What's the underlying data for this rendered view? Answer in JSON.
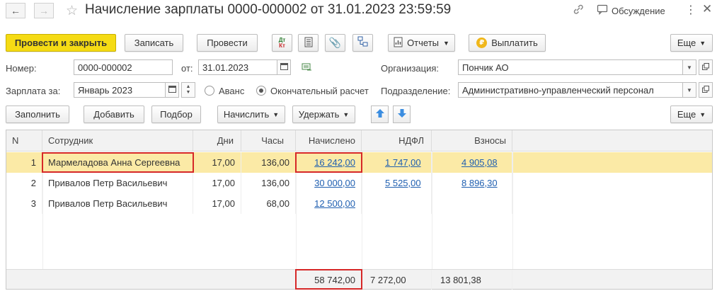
{
  "window": {
    "title": "Начисление зарплаты 0000-000002 от 31.01.2023 23:59:59",
    "discussion_label": "Обсуждение"
  },
  "toolbar": {
    "post_close": "Провести и закрыть",
    "save": "Записать",
    "post": "Провести",
    "dtkt_top": "Дт",
    "dtkt_bottom": "Кт",
    "reports": "Отчеты",
    "pay": "Выплатить",
    "more": "Еще"
  },
  "form": {
    "number_label": "Номер:",
    "number_value": "0000-000002",
    "date_label": "от:",
    "date_value": "31.01.2023",
    "org_label": "Организация:",
    "org_value": "Пончик АО",
    "salary_for_label": "Зарплата за:",
    "salary_for_value": "Январь 2023",
    "advance_label": "Аванс",
    "final_label": "Окончательный расчет",
    "division_label": "Подразделение:",
    "division_value": "Административно-управленческий персонал"
  },
  "table_toolbar": {
    "fill": "Заполнить",
    "add": "Добавить",
    "select": "Подбор",
    "accrue": "Начислить",
    "withhold": "Удержать",
    "more": "Еще"
  },
  "table": {
    "headers": [
      "N",
      "Сотрудник",
      "Дни",
      "Часы",
      "Начислено",
      "НДФЛ",
      "Взносы"
    ],
    "rows": [
      {
        "n": "1",
        "employee": "Мармеладова Анна Сергеевна",
        "days": "17,00",
        "hours": "136,00",
        "accrued": "16 242,00",
        "ndfl": "1 747,00",
        "contrib": "4 905,08"
      },
      {
        "n": "2",
        "employee": "Привалов Петр Васильевич",
        "days": "17,00",
        "hours": "136,00",
        "accrued": "30 000,00",
        "ndfl": "5 525,00",
        "contrib": "8 896,30"
      },
      {
        "n": "3",
        "employee": "Привалов Петр Васильевич",
        "days": "17,00",
        "hours": "68,00",
        "accrued": "12 500,00",
        "ndfl": "",
        "contrib": ""
      }
    ],
    "totals": {
      "accrued": "58 742,00",
      "ndfl": "7 272,00",
      "contrib": "13 801,38"
    }
  },
  "colors": {
    "primary_button": "#f5db14",
    "selected_row": "#fbeaa6",
    "link": "#1f5fb0",
    "highlight_box": "#d62828"
  }
}
